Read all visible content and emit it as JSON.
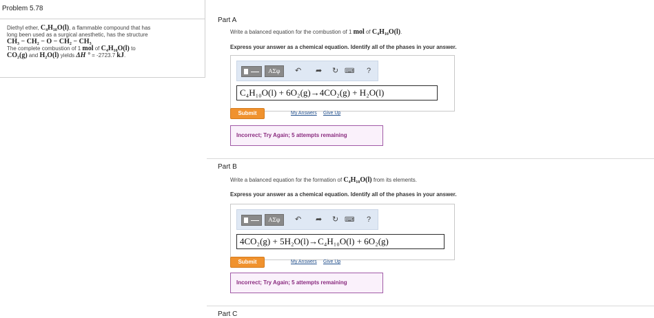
{
  "problem": {
    "title": "Problem 5.78",
    "line1_pre": "Diethyl ether, ",
    "line1_formula": "C₄H₁₀O(l)",
    "line1_post": ", a flammable compound that has",
    "line2": "long been used as a surgical anesthetic, has the structure",
    "structure": "CH₃ − CH₂ − O − CH₂ − CH₃",
    "line4_pre": "The complete combustion of 1 ",
    "line4_mol": "mol",
    "line4_mid": " of ",
    "line4_formula": "C₄H₁₀O(l)",
    "line4_post": " to",
    "line5_a": "CO₂(g)",
    "line5_b": " and ",
    "line5_c": "H₂O(l)",
    "line5_d": " yields ",
    "line5_dh": "ΔH °",
    "line5_e": " = -2723.7 ",
    "line5_unit": "kJ",
    "line5_f": "."
  },
  "toolbar": {
    "greek_label": "ΑΣφ",
    "undo_icon": "undo-icon",
    "redo_icon": "redo-icon",
    "reset_icon": "reset-icon",
    "keyboard_icon": "keyboard-icon",
    "help_label": "?"
  },
  "partA": {
    "title": "Part A",
    "question_pre": "Write a balanced equation for the combustion of 1 ",
    "question_mol": "mol",
    "question_mid": " of ",
    "question_formula": "C₄H₁₀O(l)",
    "question_post": ".",
    "instruction": "Express your answer as a chemical equation. Identify all of the phases in your answer.",
    "answer": "C₄H₁₀O(l) + 6O₂(g)→4CO₂(g) + H₂O(l)",
    "submit": "Submit",
    "my_answers": "My Answers",
    "give_up": "Give Up",
    "feedback": "Incorrect; Try Again; 5 attempts remaining"
  },
  "partB": {
    "title": "Part B",
    "question_pre": "Write a balanced equation for the formation of ",
    "question_formula": "C₄H₁₀O(l)",
    "question_post": " from its elements.",
    "instruction": "Express your answer as a chemical equation. Identify all of the phases in your answer.",
    "answer": "4CO₂(g) + 5H₂O(l)→C₄H₁₀O(l) + 6O₂(g)",
    "submit": "Submit",
    "my_answers": "My Answers",
    "give_up": "Give Up",
    "feedback": "Incorrect; Try Again; 5 attempts remaining"
  },
  "partC": {
    "title": "Part C"
  },
  "colors": {
    "submit_bg": "#f0922e",
    "feedback_border": "#a05aa6",
    "feedback_text": "#8a2b7f",
    "toolbar_bg": "#dfe8f4",
    "link": "#1f4e8c"
  }
}
